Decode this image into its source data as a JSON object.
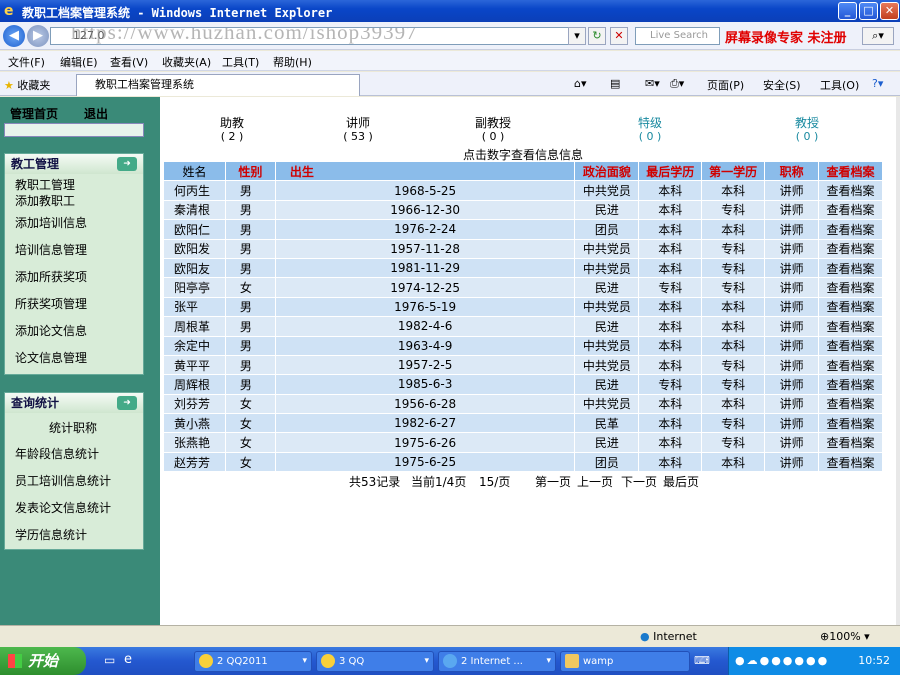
{
  "window": {
    "title": "教职工档案管理系统 - Windows Internet Explorer"
  },
  "browser": {
    "address_prefix": "127.0",
    "url_overlay": "https://www.huzhan.com/ishop39397",
    "search_placeholder": "Live Search",
    "promo": "屏幕录像专家 未注册",
    "menu": [
      "文件(F)",
      "编辑(E)",
      "查看(V)",
      "收藏夹(A)",
      "工具(T)",
      "帮助(H)"
    ],
    "favorites": "收藏夹",
    "tab_title": "教职工档案管理系统",
    "tools": [
      "页面(P)",
      "安全(S)",
      "工具(O)"
    ],
    "status_zone": "Internet",
    "zoom": "100%"
  },
  "sidebar": {
    "home": "管理首页",
    "logout": "退出",
    "staff_panel": {
      "title": "教工管理",
      "items": [
        "教职工管理",
        "添加教职工",
        "添加培训信息",
        "培训信息管理",
        "添加所获奖项",
        "所获奖项管理",
        "添加论文信息",
        "论文信息管理"
      ]
    },
    "query_panel": {
      "title": "查询统计",
      "items": [
        "统计职称",
        "年龄段信息统计",
        "员工培训信息统计",
        "发表论文信息统计",
        "学历信息统计"
      ]
    }
  },
  "stats": [
    {
      "label": "助教",
      "count": "( 2 )",
      "teal": false
    },
    {
      "label": "讲师",
      "count": "( 53 )",
      "teal": false
    },
    {
      "label": "副教授",
      "count": "( 0 )",
      "teal": false
    },
    {
      "label": "特级",
      "count": "( 0 )",
      "teal": true
    },
    {
      "label": "教授",
      "count": "( 0 )",
      "teal": true
    }
  ],
  "hint": "点击数字查看信息信息",
  "table": {
    "headers": [
      "姓名",
      "性别",
      "出生",
      "政治面貌",
      "最后学历",
      "第一学历",
      "职称",
      "查看档案"
    ],
    "rows": [
      [
        "何丙生",
        "男",
        "1968-5-25",
        "中共党员",
        "本科",
        "本科",
        "讲师",
        "查看档案"
      ],
      [
        "秦清根",
        "男",
        "1966-12-30",
        "民进",
        "本科",
        "专科",
        "讲师",
        "查看档案"
      ],
      [
        "欧阳仁",
        "男",
        "1976-2-24",
        "团员",
        "本科",
        "本科",
        "讲师",
        "查看档案"
      ],
      [
        "欧阳发",
        "男",
        "1957-11-28",
        "中共党员",
        "本科",
        "专科",
        "讲师",
        "查看档案"
      ],
      [
        "欧阳友",
        "男",
        "1981-11-29",
        "中共党员",
        "本科",
        "专科",
        "讲师",
        "查看档案"
      ],
      [
        "阳亭亭",
        "女",
        "1974-12-25",
        "民进",
        "专科",
        "专科",
        "讲师",
        "查看档案"
      ],
      [
        "张平",
        "男",
        "1976-5-19",
        "中共党员",
        "本科",
        "本科",
        "讲师",
        "查看档案"
      ],
      [
        "周根革",
        "男",
        "1982-4-6",
        "民进",
        "本科",
        "本科",
        "讲师",
        "查看档案"
      ],
      [
        "余定中",
        "男",
        "1963-4-9",
        "中共党员",
        "本科",
        "本科",
        "讲师",
        "查看档案"
      ],
      [
        "黄平平",
        "男",
        "1957-2-5",
        "中共党员",
        "本科",
        "专科",
        "讲师",
        "查看档案"
      ],
      [
        "周辉根",
        "男",
        "1985-6-3",
        "民进",
        "专科",
        "专科",
        "讲师",
        "查看档案"
      ],
      [
        "刘芬芳",
        "女",
        "1956-6-28",
        "中共党员",
        "本科",
        "本科",
        "讲师",
        "查看档案"
      ],
      [
        "黄小燕",
        "女",
        "1982-6-27",
        "民革",
        "本科",
        "专科",
        "讲师",
        "查看档案"
      ],
      [
        "张燕艳",
        "女",
        "1975-6-26",
        "民进",
        "本科",
        "专科",
        "讲师",
        "查看档案"
      ],
      [
        "赵芳芳",
        "女",
        "1975-6-25",
        "团员",
        "本科",
        "本科",
        "讲师",
        "查看档案"
      ]
    ]
  },
  "pager": {
    "total": "共53记录",
    "current": "当前1/4页",
    "per_page": "15/页",
    "first": "第一页",
    "prev": "上一页",
    "next": "下一页",
    "last": "最后页"
  },
  "taskbar": {
    "start": "开始",
    "items": [
      "2 QQ2011",
      "3 QQ",
      "2 Internet ...",
      "wamp"
    ],
    "clock": "10:52"
  }
}
